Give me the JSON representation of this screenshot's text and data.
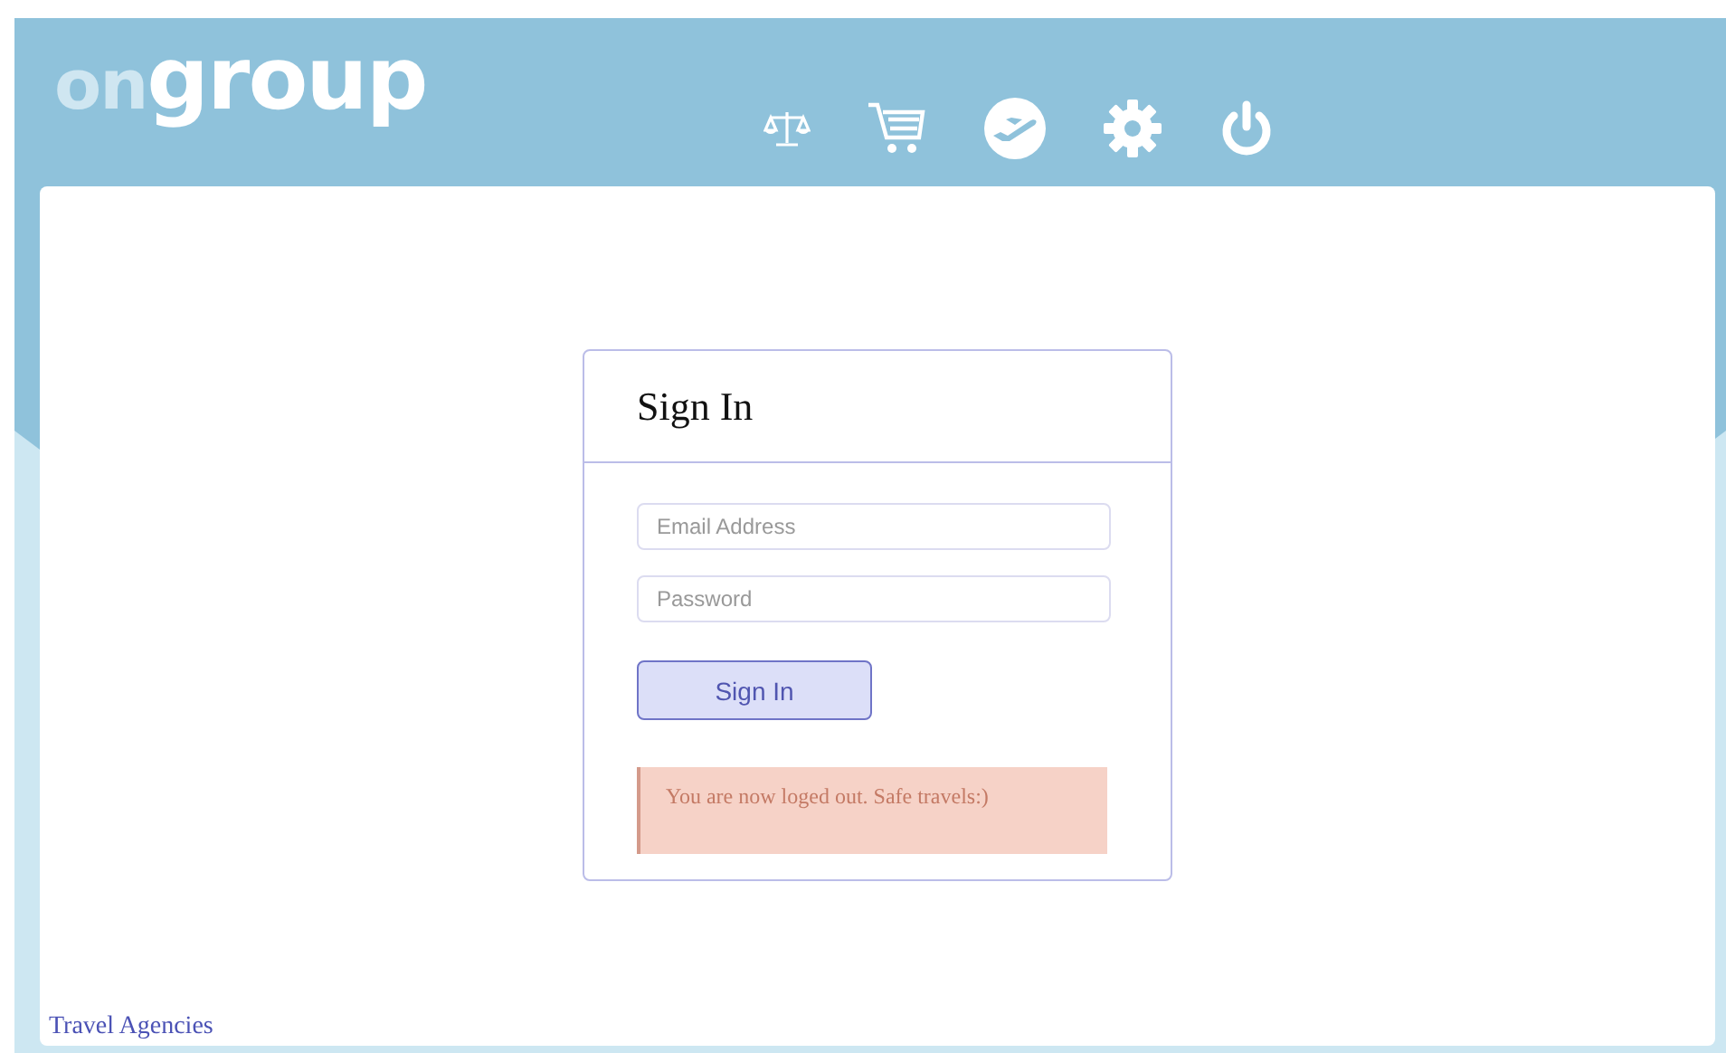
{
  "logo": {
    "prefix": "on",
    "main": "group"
  },
  "signin": {
    "title": "Sign In",
    "fields": [
      {
        "placeholder": "Email Address"
      },
      {
        "placeholder": "Password"
      }
    ],
    "button": "Sign In",
    "alert": "You are now loged out. Safe travels:)"
  },
  "footer_link": "Travel Agencies"
}
